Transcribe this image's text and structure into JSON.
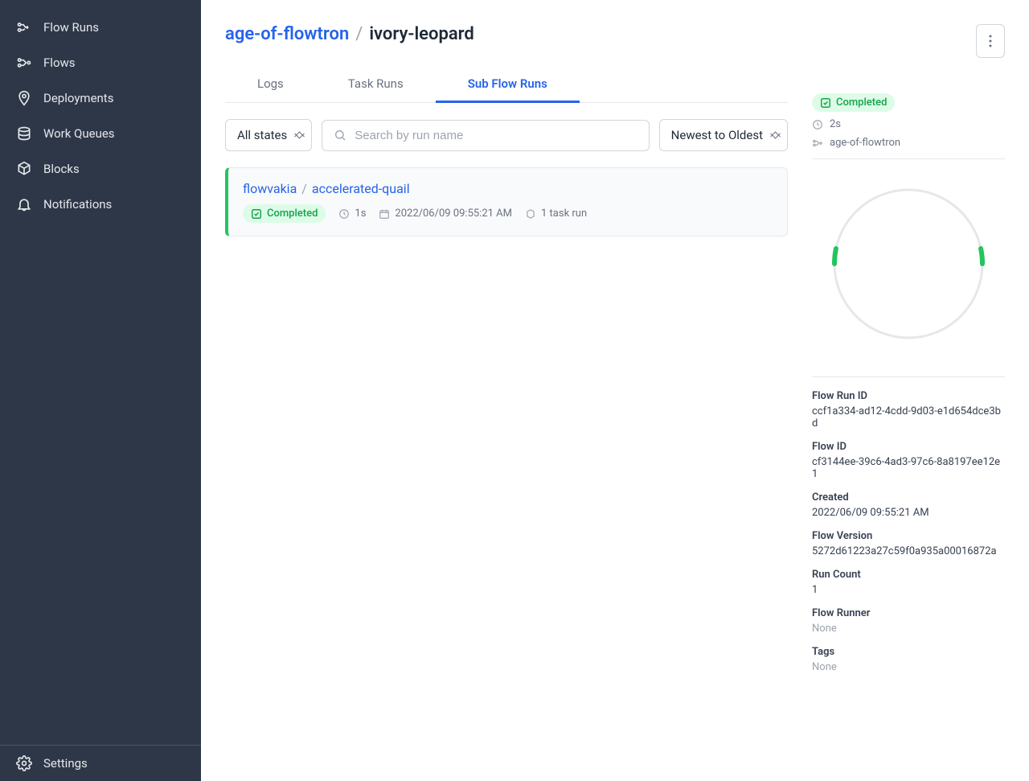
{
  "sidebar": {
    "items": [
      {
        "label": "Flow Runs"
      },
      {
        "label": "Flows"
      },
      {
        "label": "Deployments"
      },
      {
        "label": "Work Queues"
      },
      {
        "label": "Blocks"
      },
      {
        "label": "Notifications"
      }
    ],
    "settings_label": "Settings"
  },
  "breadcrumb": {
    "flow": "age-of-flowtron",
    "divider": "/",
    "run": "ivory-leopard"
  },
  "tabs": {
    "logs": "Logs",
    "task_runs": "Task Runs",
    "sub_flow_runs": "Sub Flow Runs"
  },
  "controls": {
    "state_filter": "All states",
    "search_placeholder": "Search by run name",
    "sort": "Newest to Oldest"
  },
  "run_card": {
    "flow": "flowvakia",
    "divider": "/",
    "name": "accelerated-quail",
    "status": "Completed",
    "duration": "1s",
    "timestamp": "2022/06/09 09:55:21 AM",
    "task_count": "1 task run"
  },
  "summary": {
    "status": "Completed",
    "duration": "2s",
    "flow_name": "age-of-flowtron"
  },
  "details": [
    {
      "label": "Flow Run ID",
      "value": "ccf1a334-ad12-4cdd-9d03-e1d654dce3bd"
    },
    {
      "label": "Flow ID",
      "value": "cf3144ee-39c6-4ad3-97c6-8a8197ee12e1"
    },
    {
      "label": "Created",
      "value": "2022/06/09 09:55:21 AM"
    },
    {
      "label": "Flow Version",
      "value": "5272d61223a27c59f0a935a00016872a"
    },
    {
      "label": "Run Count",
      "value": "1"
    },
    {
      "label": "Flow Runner",
      "value": "None",
      "muted": true
    },
    {
      "label": "Tags",
      "value": "None",
      "muted": true
    }
  ]
}
